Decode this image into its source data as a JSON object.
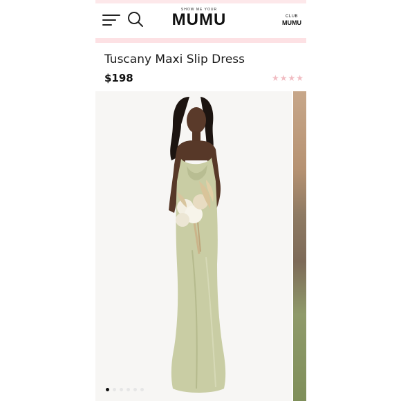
{
  "header": {
    "brand_small": "SHOW ME YOUR",
    "brand_big": "MUMU",
    "club_top": "CLUB",
    "club_bottom": "MUMU",
    "menu_icon": "hamburger-menu-icon",
    "search_icon": "search-icon"
  },
  "product": {
    "title": "Tuscany Maxi Slip Dress",
    "price": "$198",
    "rating_stars": "★★★★"
  },
  "gallery": {
    "image": "model-in-sage-satin-slip-dress-with-bouquet",
    "active_index": 1,
    "dot_count": 6
  },
  "colors": {
    "accent_pink": "#fde1e4",
    "star_pink": "#f1bcc2",
    "dress_sage": "#c9cda4"
  }
}
